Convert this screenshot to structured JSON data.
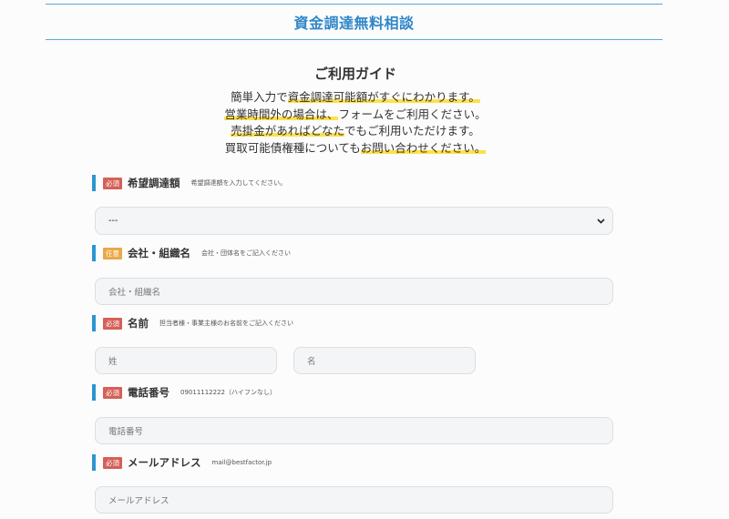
{
  "header": {
    "title": "資金調達無料相談"
  },
  "guide": {
    "title": "ご利用ガイド",
    "lines": [
      [
        {
          "text": "簡単入力で",
          "hl": false
        },
        {
          "text": "資金調達可能額がすぐにわかります。",
          "hl": true
        }
      ],
      [
        {
          "text": "営業時間外の場合は、",
          "hl": true
        },
        {
          "text": "フォームをご利用ください。",
          "hl": false
        }
      ],
      [
        {
          "text": "売掛金があればどなた",
          "hl": true
        },
        {
          "text": "でもご利用いただけます。",
          "hl": false
        }
      ],
      [
        {
          "text": "買取可能債権種についても",
          "hl": false
        },
        {
          "text": "お問い合わせください。",
          "hl": true
        }
      ]
    ]
  },
  "fields": {
    "amount": {
      "badge": "必須",
      "label": "希望調達額",
      "hint": "希望調達額を入力してください。",
      "select_value": "---"
    },
    "company": {
      "badge": "任意",
      "label": "会社・組織名",
      "hint": "会社・団体名をご記入ください",
      "placeholder": "会社・組織名"
    },
    "name": {
      "badge": "必須",
      "label": "名前",
      "hint": "担当者様・事業主様のお名前をご記入ください",
      "last_placeholder": "姓",
      "first_placeholder": "名"
    },
    "phone": {
      "badge": "必須",
      "label": "電話番号",
      "hint": "09011112222（ハイフンなし）",
      "placeholder": "電話番号"
    },
    "email": {
      "badge": "必須",
      "label": "メールアドレス",
      "hint": "mail@bestfactor.jp",
      "placeholder": "メールアドレス"
    }
  },
  "colors": {
    "accent": "#2b95cf",
    "header_text": "#2f86c8",
    "required_badge": "#d46057",
    "optional_badge": "#eaa848",
    "highlight": "#ffe04a"
  }
}
